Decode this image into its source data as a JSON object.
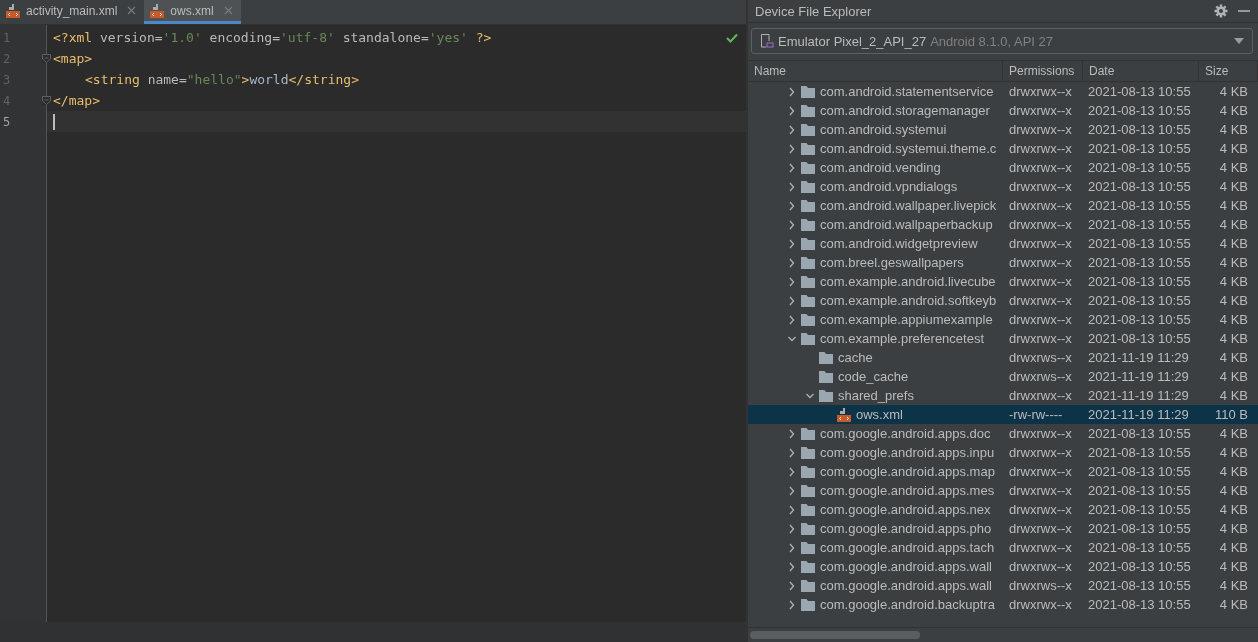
{
  "editor_tabs": [
    {
      "label": "activity_main.xml",
      "selected": false
    },
    {
      "label": "ows.xml",
      "selected": true
    }
  ],
  "editor": {
    "inspection_ok": true,
    "lines": [
      {
        "number": "1",
        "current": false,
        "fold": false,
        "tokens": [
          {
            "kind": "tag",
            "text": "<?xml "
          },
          {
            "kind": "attr",
            "text": "version="
          },
          {
            "kind": "string",
            "text": "'1.0' "
          },
          {
            "kind": "attr",
            "text": "encoding="
          },
          {
            "kind": "string",
            "text": "'utf-8' "
          },
          {
            "kind": "attr",
            "text": "standalone="
          },
          {
            "kind": "string",
            "text": "'yes' "
          },
          {
            "kind": "tag",
            "text": "?>"
          }
        ]
      },
      {
        "number": "2",
        "current": false,
        "fold": true,
        "tokens": [
          {
            "kind": "tag",
            "text": "<map>"
          }
        ]
      },
      {
        "number": "3",
        "current": false,
        "fold": false,
        "indented": true,
        "tokens": [
          {
            "kind": "tag",
            "text": "<string "
          },
          {
            "kind": "attr",
            "text": "name="
          },
          {
            "kind": "string",
            "text": "\"hello\""
          },
          {
            "kind": "tag",
            "text": ">"
          },
          {
            "kind": "text",
            "text": "world"
          },
          {
            "kind": "tag",
            "text": "</string>"
          }
        ]
      },
      {
        "number": "4",
        "current": false,
        "fold": true,
        "tokens": [
          {
            "kind": "tag",
            "text": "</map>"
          }
        ]
      },
      {
        "number": "5",
        "current": true,
        "fold": false
      }
    ]
  },
  "explorer": {
    "title": "Device File Explorer",
    "device": {
      "name": "Emulator Pixel_2_API_27",
      "detail": "Android 8.1.0, API 27"
    },
    "columns": [
      "Name",
      "Permissions",
      "Date",
      "Size"
    ],
    "tree": [
      {
        "kind": "folder",
        "expanded": false,
        "selected": false,
        "name": "com.android.statementservice",
        "permissions": "drwxrwx--x",
        "date": "2021-08-13 10:55",
        "size": "4 KB"
      },
      {
        "kind": "folder",
        "expanded": false,
        "selected": false,
        "name": "com.android.storagemanager",
        "permissions": "drwxrwx--x",
        "date": "2021-08-13 10:55",
        "size": "4 KB"
      },
      {
        "kind": "folder",
        "expanded": false,
        "selected": false,
        "name": "com.android.systemui",
        "permissions": "drwxrwx--x",
        "date": "2021-08-13 10:55",
        "size": "4 KB"
      },
      {
        "kind": "folder",
        "expanded": false,
        "selected": false,
        "name": "com.android.systemui.theme.c",
        "permissions": "drwxrwx--x",
        "date": "2021-08-13 10:55",
        "size": "4 KB"
      },
      {
        "kind": "folder",
        "expanded": false,
        "selected": false,
        "name": "com.android.vending",
        "permissions": "drwxrwx--x",
        "date": "2021-08-13 10:55",
        "size": "4 KB"
      },
      {
        "kind": "folder",
        "expanded": false,
        "selected": false,
        "name": "com.android.vpndialogs",
        "permissions": "drwxrwx--x",
        "date": "2021-08-13 10:55",
        "size": "4 KB"
      },
      {
        "kind": "folder",
        "expanded": false,
        "selected": false,
        "name": "com.android.wallpaper.livepick",
        "permissions": "drwxrwx--x",
        "date": "2021-08-13 10:55",
        "size": "4 KB"
      },
      {
        "kind": "folder",
        "expanded": false,
        "selected": false,
        "name": "com.android.wallpaperbackup",
        "permissions": "drwxrwx--x",
        "date": "2021-08-13 10:55",
        "size": "4 KB"
      },
      {
        "kind": "folder",
        "expanded": false,
        "selected": false,
        "name": "com.android.widgetpreview",
        "permissions": "drwxrwx--x",
        "date": "2021-08-13 10:55",
        "size": "4 KB"
      },
      {
        "kind": "folder",
        "expanded": false,
        "selected": false,
        "name": "com.breel.geswallpapers",
        "permissions": "drwxrwx--x",
        "date": "2021-08-13 10:55",
        "size": "4 KB"
      },
      {
        "kind": "folder",
        "expanded": false,
        "selected": false,
        "name": "com.example.android.livecube",
        "permissions": "drwxrwx--x",
        "date": "2021-08-13 10:55",
        "size": "4 KB"
      },
      {
        "kind": "folder",
        "expanded": false,
        "selected": false,
        "name": "com.example.android.softkeyb",
        "permissions": "drwxrwx--x",
        "date": "2021-08-13 10:55",
        "size": "4 KB"
      },
      {
        "kind": "folder",
        "expanded": false,
        "selected": false,
        "name": "com.example.appiumexample",
        "permissions": "drwxrwx--x",
        "date": "2021-08-13 10:55",
        "size": "4 KB"
      },
      {
        "kind": "folder",
        "expanded": true,
        "selected": false,
        "name": "com.example.preferencetest",
        "permissions": "drwxrwx--x",
        "date": "2021-08-13 10:55",
        "size": "4 KB",
        "children": [
          {
            "kind": "empty-folder",
            "selected": false,
            "name": "cache",
            "permissions": "drwxrws--x",
            "date": "2021-11-19 11:29",
            "size": "4 KB"
          },
          {
            "kind": "empty-folder",
            "selected": false,
            "name": "code_cache",
            "permissions": "drwxrws--x",
            "date": "2021-11-19 11:29",
            "size": "4 KB"
          },
          {
            "kind": "folder",
            "expanded": true,
            "selected": false,
            "name": "shared_prefs",
            "permissions": "drwxrwx--x",
            "date": "2021-11-19 11:29",
            "size": "4 KB",
            "children": [
              {
                "kind": "file",
                "selected": true,
                "name": "ows.xml",
                "permissions": "-rw-rw----",
                "date": "2021-11-19 11:29",
                "size": "110 B"
              }
            ]
          }
        ]
      },
      {
        "kind": "folder",
        "expanded": false,
        "selected": false,
        "name": "com.google.android.apps.doc",
        "permissions": "drwxrwx--x",
        "date": "2021-08-13 10:55",
        "size": "4 KB"
      },
      {
        "kind": "folder",
        "expanded": false,
        "selected": false,
        "name": "com.google.android.apps.inpu",
        "permissions": "drwxrwx--x",
        "date": "2021-08-13 10:55",
        "size": "4 KB"
      },
      {
        "kind": "folder",
        "expanded": false,
        "selected": false,
        "name": "com.google.android.apps.map",
        "permissions": "drwxrwx--x",
        "date": "2021-08-13 10:55",
        "size": "4 KB"
      },
      {
        "kind": "folder",
        "expanded": false,
        "selected": false,
        "name": "com.google.android.apps.mes",
        "permissions": "drwxrwx--x",
        "date": "2021-08-13 10:55",
        "size": "4 KB"
      },
      {
        "kind": "folder",
        "expanded": false,
        "selected": false,
        "name": "com.google.android.apps.nex",
        "permissions": "drwxrwx--x",
        "date": "2021-08-13 10:55",
        "size": "4 KB"
      },
      {
        "kind": "folder",
        "expanded": false,
        "selected": false,
        "name": "com.google.android.apps.pho",
        "permissions": "drwxrwx--x",
        "date": "2021-08-13 10:55",
        "size": "4 KB"
      },
      {
        "kind": "folder",
        "expanded": false,
        "selected": false,
        "name": "com.google.android.apps.tach",
        "permissions": "drwxrwx--x",
        "date": "2021-08-13 10:55",
        "size": "4 KB"
      },
      {
        "kind": "folder",
        "expanded": false,
        "selected": false,
        "name": "com.google.android.apps.wall",
        "permissions": "drwxrwx--x",
        "date": "2021-08-13 10:55",
        "size": "4 KB"
      },
      {
        "kind": "folder",
        "expanded": false,
        "selected": false,
        "name": "com.google.android.apps.wall",
        "permissions": "drwxrws--x",
        "date": "2021-08-13 10:55",
        "size": "4 KB"
      },
      {
        "kind": "folder",
        "expanded": false,
        "selected": false,
        "name": "com.google.android.backuptra",
        "permissions": "drwxrwx--x",
        "date": "2021-08-13 10:55",
        "size": "4 KB"
      }
    ]
  }
}
